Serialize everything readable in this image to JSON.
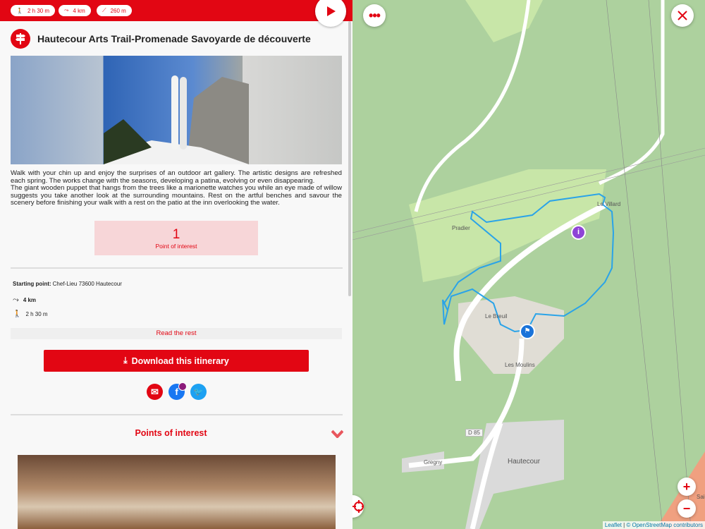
{
  "header": {
    "duration": "2 h 30 m",
    "distance": "4 km",
    "elevation": "260 m"
  },
  "title": "Hautecour Arts Trail-Promenade Savoyarde de découverte",
  "description": [
    "Walk with your chin up and enjoy the surprises of an outdoor art gallery. The artistic designs are refreshed each spring. The works change with the seasons, developing a patina, evolving or even disappearing.",
    "The giant wooden puppet that hangs from the trees like a marionette watches you while an eye made of willow suggests you take another look at the surrounding mountains. Rest on the artful benches and savour the scenery before finishing your walk with a rest on the patio at the inn overlooking the water."
  ],
  "poi_summary": {
    "count": "1",
    "label": "Point of interest"
  },
  "details": {
    "starting_label": "Starting point:",
    "starting_value": "Chef-Lieu 73600 Hautecour",
    "distance": "4 km",
    "duration": "2 h 30 m"
  },
  "read_rest": "Read the rest",
  "download": "Download this itinerary",
  "poi_section": "Points of interest",
  "map": {
    "labels": {
      "pradier": "Pradier",
      "villard": "Le Villard",
      "breuil": "Le Breuil",
      "moulins": "Les Moulins",
      "road": "D 85",
      "gregny": "Gregny",
      "hautecour": "Hautecour",
      "saint": "Sain"
    },
    "zoom_in": "+",
    "zoom_out": "−",
    "attribution_leaflet": "Leaflet",
    "attribution_osm": "© OpenStreetMap contributors"
  },
  "colors": {
    "brand": "#e20613",
    "route": "#2aa3e8"
  }
}
